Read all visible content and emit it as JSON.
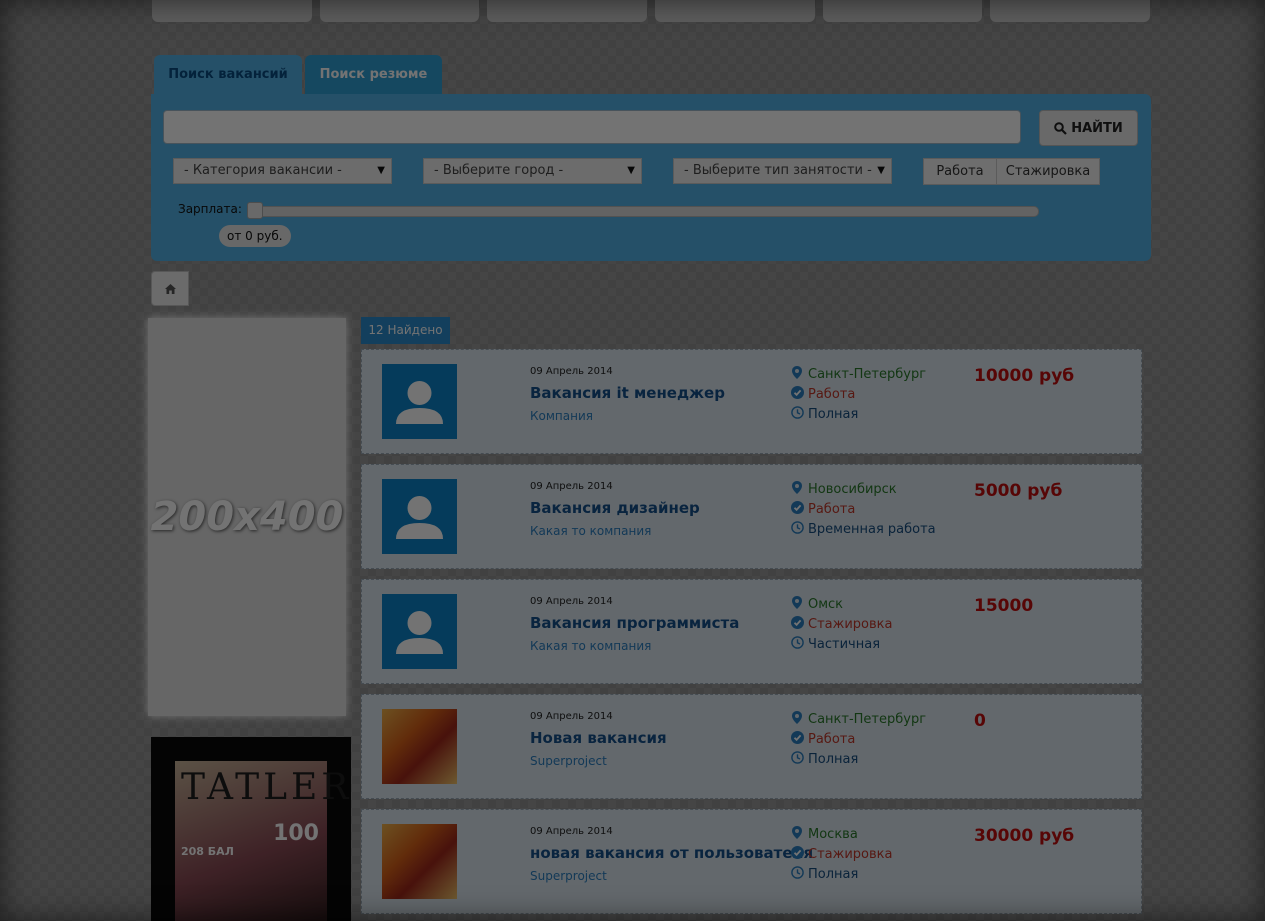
{
  "tabs": [
    {
      "label": "Поиск вакансий"
    },
    {
      "label": "Поиск резюме"
    }
  ],
  "search": {
    "placeholder": "",
    "button_label": "НАЙТИ",
    "button_icon": "search-icon"
  },
  "filters": {
    "category": "- Категория вакансии -",
    "city": "- Выберите город -",
    "employment": "- Выберите тип занятости -",
    "toggle": [
      "Работа",
      "Стажировка"
    ]
  },
  "salary": {
    "label": "Зарплата:",
    "value": "от 0 руб.",
    "slider_value": 0
  },
  "breadcrumb": {
    "icon": "home-icon"
  },
  "ad": {
    "label": "200x400"
  },
  "magazine": {
    "brand": "TATLER",
    "big": "100",
    "small": "208 БАЛ"
  },
  "results": {
    "count_label": "12 Найдено",
    "jobs": [
      {
        "date": "09 Апрель 2014",
        "title": "Вакансия it менеджер",
        "company": "Компания",
        "city": "Санкт-Петербург",
        "type": "Работа",
        "employment": "Полная",
        "price": "10000 руб",
        "image": "avatar"
      },
      {
        "date": "09 Апрель 2014",
        "title": "Вакансия дизайнер",
        "company": "Какая то компания",
        "city": "Новосибирск",
        "type": "Работа",
        "employment": "Временная работа",
        "price": "5000 руб",
        "image": "avatar"
      },
      {
        "date": "09 Апрель 2014",
        "title": "Вакансия программиста",
        "company": "Какая то компания",
        "city": "Омск",
        "type": "Стажировка",
        "employment": "Частичная",
        "price": "15000",
        "image": "avatar"
      },
      {
        "date": "09 Апрель 2014",
        "title": "Новая вакансия",
        "company": "Superproject",
        "city": "Санкт-Петербург",
        "type": "Работа",
        "employment": "Полная",
        "price": "0",
        "image": "photo"
      },
      {
        "date": "09 Апрель 2014",
        "title": "новая вакансия от пользователя",
        "company": "Superproject",
        "city": "Москва",
        "type": "Стажировка",
        "employment": "Полная",
        "price": "30000 руб",
        "image": "photo"
      }
    ]
  },
  "colors": {
    "accent": "#52b2e6",
    "price": "#c20e0e",
    "city": "#2a7a2a",
    "type": "#c0392b"
  }
}
